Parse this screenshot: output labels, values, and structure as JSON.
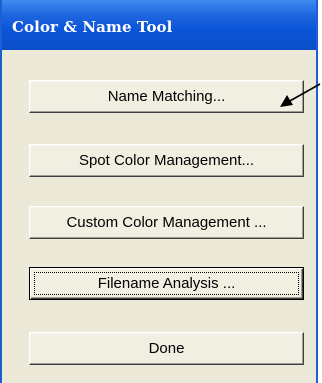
{
  "window": {
    "title": "Color & Name Tool"
  },
  "buttons": [
    {
      "label": "Name Matching..."
    },
    {
      "label": "Spot Color Management..."
    },
    {
      "label": "Custom Color Management ..."
    },
    {
      "label": "Filename Analysis ..."
    },
    {
      "label": "Done"
    }
  ],
  "colors": {
    "titlebar": "#0a54d8",
    "window_bg": "#ece9d8",
    "button_face": "#f1efe2",
    "title_text": "#ffffff"
  },
  "annotation": {
    "icon": "arrow-icon"
  }
}
